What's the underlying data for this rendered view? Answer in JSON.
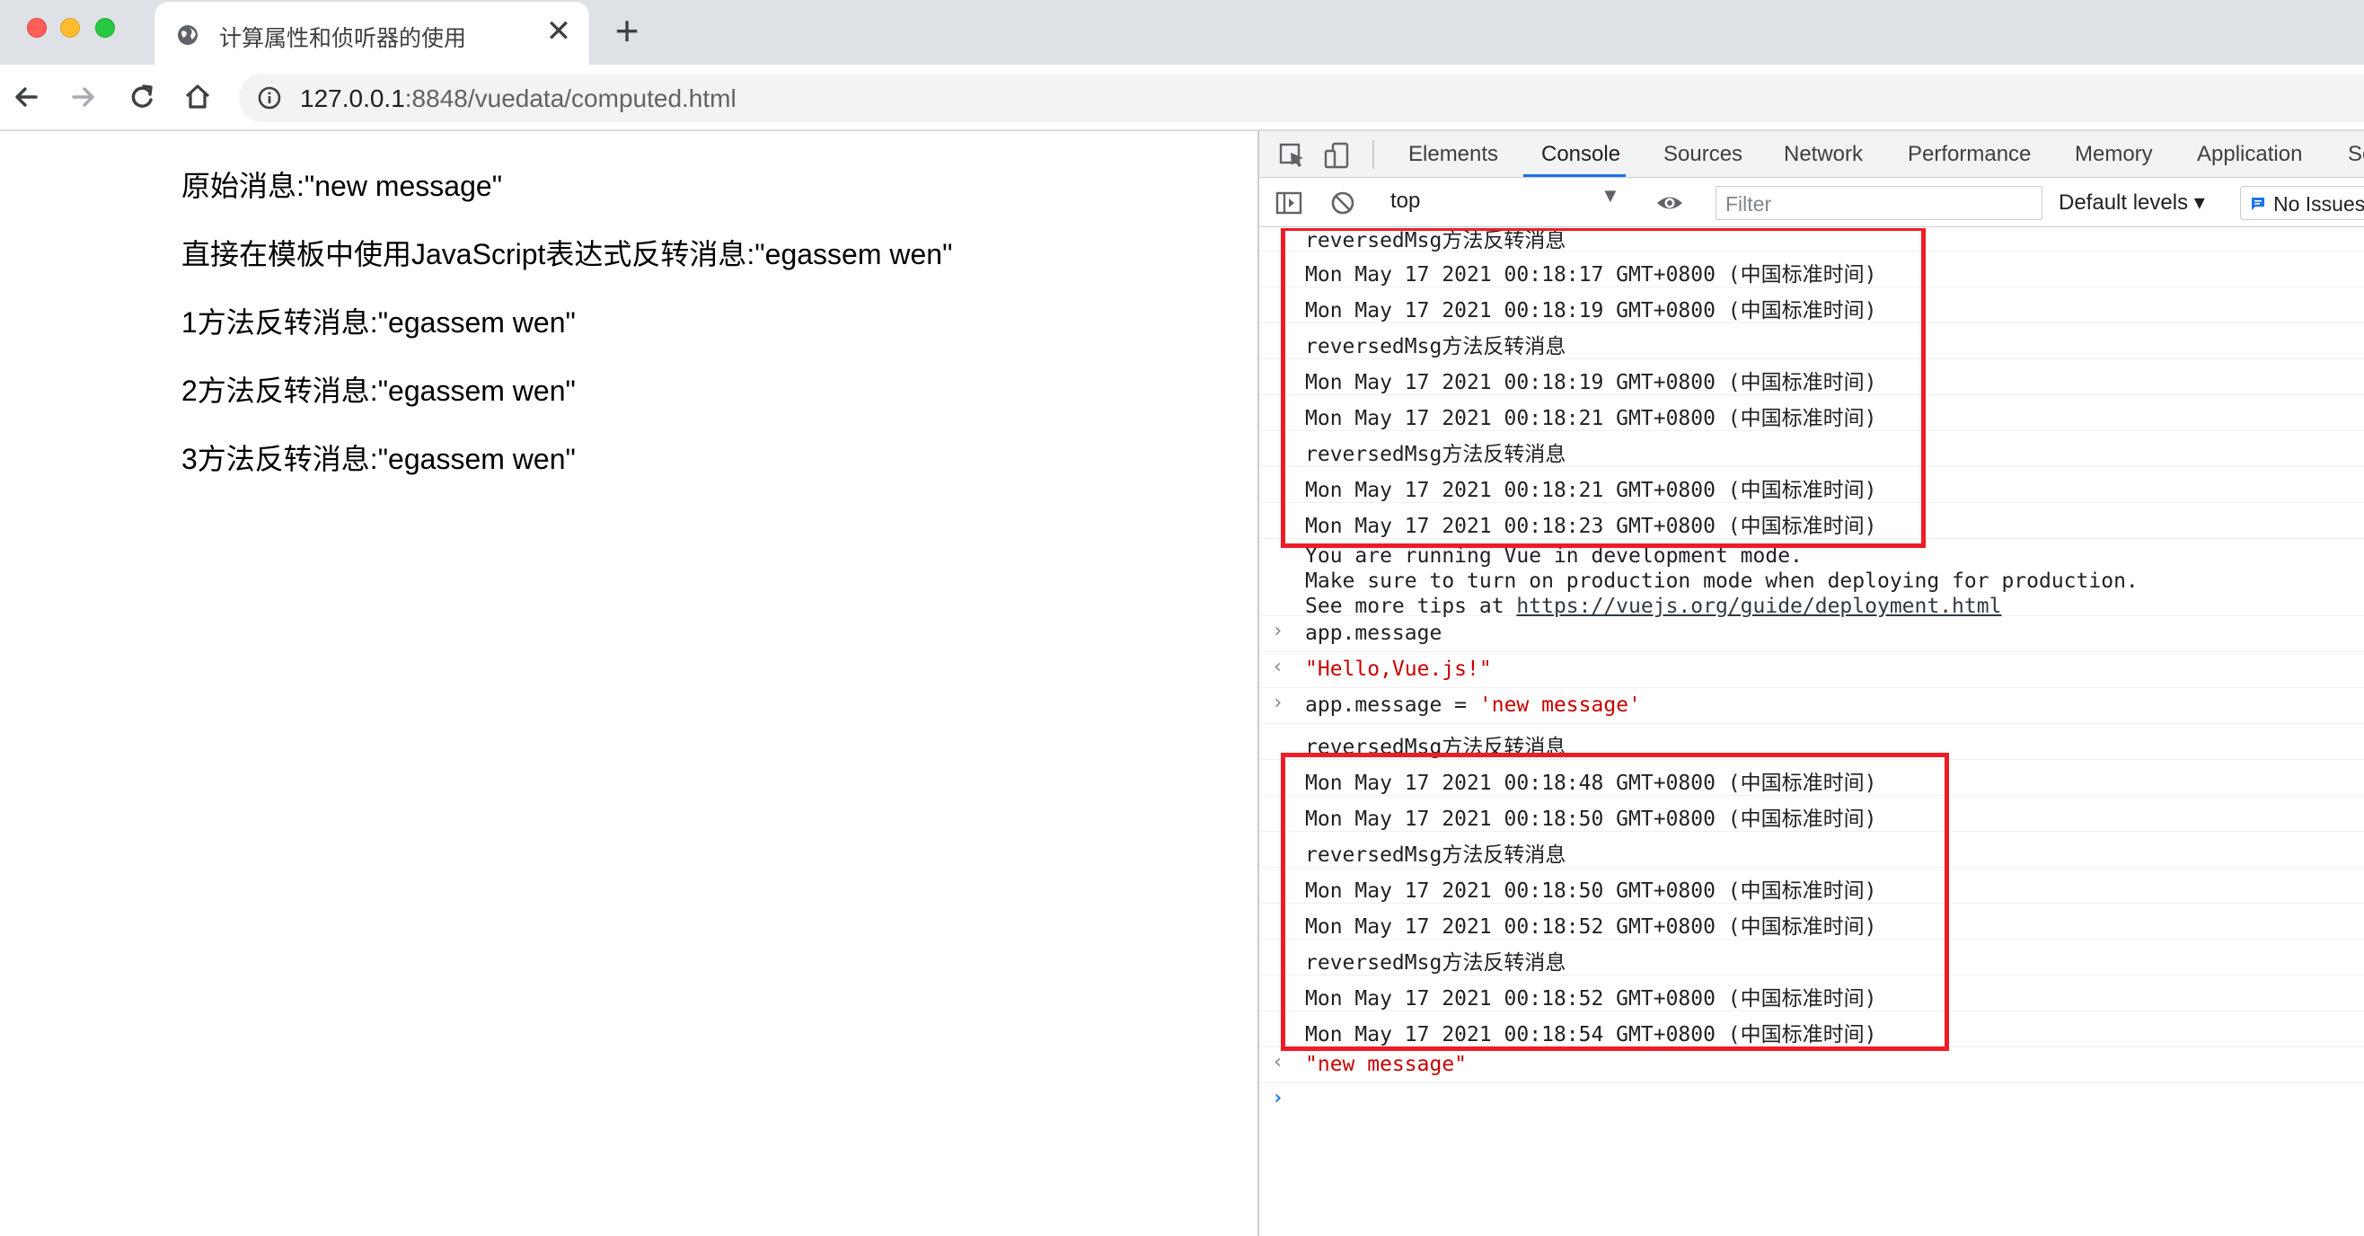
{
  "browser": {
    "tab_title": "计算属性和侦听器的使用",
    "tab_close": "✕",
    "new_tab": "+",
    "url_host": "127.0.0.1",
    "url_rest": ":8848/vuedata/computed.html"
  },
  "page": {
    "lines": [
      "原始消息:\"new message\"",
      "直接在模板中使用JavaScript表达式反转消息:\"egassem wen\"",
      "1方法反转消息:\"egassem wen\"",
      "2方法反转消息:\"egassem wen\"",
      "3方法反转消息:\"egassem wen\""
    ]
  },
  "devtools": {
    "tabs": [
      "Elements",
      "Console",
      "Sources",
      "Network",
      "Performance",
      "Memory",
      "Application",
      "Se"
    ],
    "active_tab": "Console",
    "context": "top",
    "filter_placeholder": "Filter",
    "levels": "Default levels ▾",
    "issues": "No Issues"
  },
  "console": {
    "group1": [
      "reversedMsg方法反转消息",
      "Mon May 17 2021 00:18:17 GMT+0800 (中国标准时间)",
      "Mon May 17 2021 00:18:19 GMT+0800 (中国标准时间)",
      "reversedMsg方法反转消息",
      "Mon May 17 2021 00:18:19 GMT+0800 (中国标准时间)",
      "Mon May 17 2021 00:18:21 GMT+0800 (中国标准时间)",
      "reversedMsg方法反转消息",
      "Mon May 17 2021 00:18:21 GMT+0800 (中国标准时间)",
      "Mon May 17 2021 00:18:23 GMT+0800 (中国标准时间)"
    ],
    "vue_notice_1": "You are running Vue in development mode.",
    "vue_notice_2": "Make sure to turn on production mode when deploying for production.",
    "vue_notice_3_prefix": "See more tips at ",
    "vue_notice_3_link": "https://vuejs.org/guide/deployment.html",
    "input1": "app.message",
    "output1": "\"Hello,Vue.js!\"",
    "input2_lhs": "app.message = ",
    "input2_rhs": "'new message'",
    "group2": [
      "reversedMsg方法反转消息",
      "Mon May 17 2021 00:18:48 GMT+0800 (中国标准时间)",
      "Mon May 17 2021 00:18:50 GMT+0800 (中国标准时间)",
      "reversedMsg方法反转消息",
      "Mon May 17 2021 00:18:50 GMT+0800 (中国标准时间)",
      "Mon May 17 2021 00:18:52 GMT+0800 (中国标准时间)",
      "reversedMsg方法反转消息",
      "Mon May 17 2021 00:18:52 GMT+0800 (中国标准时间)",
      "Mon May 17 2021 00:18:54 GMT+0800 (中国标准时间)"
    ],
    "output2": "\"new message\"",
    "prompt": "›",
    "input_arrow": "›",
    "output_arrow": "‹"
  },
  "colors": {
    "highlight_box": "#ee1c25",
    "active_tab_underline": "#1a73e8",
    "string_value": "#c80000"
  }
}
